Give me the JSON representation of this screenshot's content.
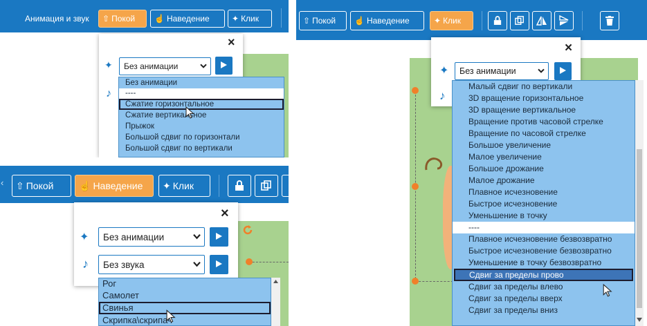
{
  "panel_a": {
    "label_animation_sound": "Анимация и звук",
    "tabs": {
      "rest": "Покой",
      "hover": "Наведение",
      "click": "Клик"
    },
    "close": "×",
    "animation_select": "Без анимации",
    "list": [
      "Без анимации",
      "----",
      "Сжатие горизонтальное",
      "Сжатие вертикальное",
      "Прыжок",
      "Большой сдвиг по горизонтали",
      "Большой сдвиг по вертикали"
    ],
    "highlighted_index": 2
  },
  "panel_b": {
    "tabs": {
      "rest": "Покой",
      "hover": "Наведение",
      "click": "Клик"
    },
    "close": "×",
    "animation_select": "Без анимации",
    "sound_select": "Без звука",
    "list": [
      "Рог",
      "Самолет",
      "Свинья",
      "Скрипка\\скрипач"
    ],
    "highlighted_index": 2
  },
  "panel_c": {
    "tabs": {
      "rest": "Покой",
      "hover": "Наведение",
      "click": "Клик"
    },
    "close": "×",
    "animation_select": "Без анимации",
    "list": [
      "Малый сдвиг по вертикали",
      "3D вращение горизонтальное",
      "3D вращение вертикальное",
      "Вращение против часовой стрелке",
      "Вращение по часовой стрелке",
      "Большое увеличение",
      "Малое увеличение",
      "Большое дрожание",
      "Малое дрожание",
      "Плавное исчезновение",
      "Быстрое исчезновение",
      "Уменьшение в точку",
      "----",
      "Плавное исчезновение безвозвратно",
      "Быстрое исчезновение безвозвратно",
      "Уменьшение в точку безвозвратно",
      "Сдвиг за пределы прово",
      "Сдвиг за пределы влево",
      "Сдвиг за пределы вверх",
      "Сдвиг за пределы вниз"
    ],
    "highlighted_index": 16
  },
  "colors": {
    "toolbar_blue": "#1a78c2",
    "active_orange": "#f5a54a",
    "list_blue": "#8dc3ee",
    "highlight_dark": "#3d74b7",
    "canvas_green": "#a8d28f",
    "handle_orange": "#f0802a"
  },
  "icons": [
    "hand-up-icon",
    "pointer-hand-icon",
    "click-sparkle-icon",
    "animation-icon",
    "music-note-icon",
    "play-icon",
    "chevron-down-icon",
    "close-icon",
    "lock-icon",
    "copy-icon",
    "flip-horizontal-icon",
    "flip-vertical-icon",
    "trash-icon",
    "rotate-icon",
    "mouse-cursor-icon"
  ]
}
